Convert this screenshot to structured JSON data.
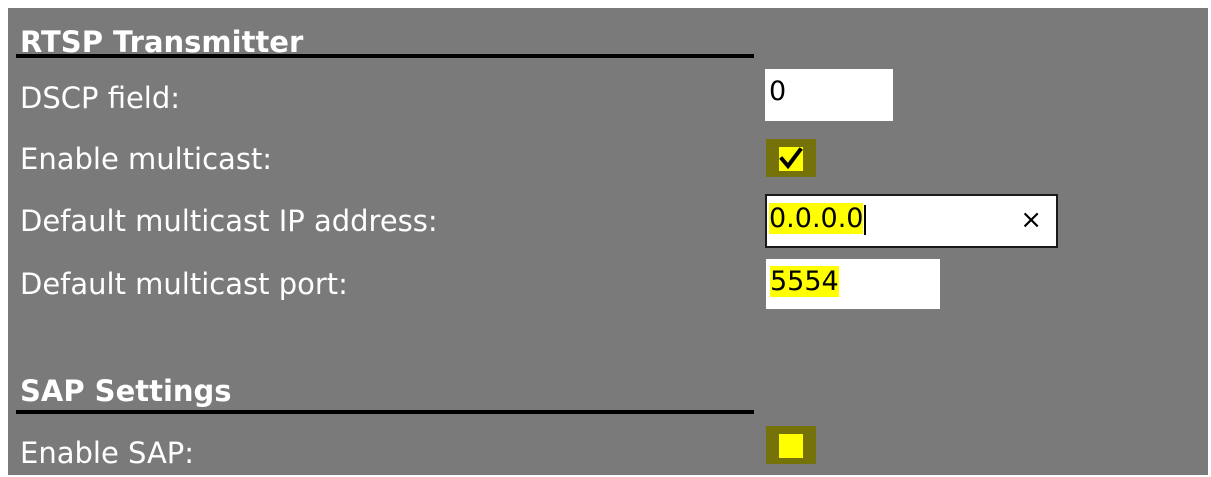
{
  "rtsp": {
    "title": "RTSP Transmitter",
    "dscp_label": "DSCP field:",
    "dscp_value": "0",
    "multicast_label": "Enable multicast:",
    "multicast_checked": true,
    "ip_label": "Default multicast IP address:",
    "ip_value": "0.0.0.0",
    "clear_glyph": "×",
    "port_label": "Default multicast port:",
    "port_value": "5554"
  },
  "sap": {
    "title": "SAP Settings",
    "enable_label": "Enable SAP:",
    "enable_checked": false
  },
  "icons": {
    "check": "checkmark-icon",
    "clear": "close-icon"
  },
  "colors": {
    "panel_bg": "#7a7a7a",
    "highlight": "#ffff00",
    "checkbox_focus": "#76720a"
  }
}
